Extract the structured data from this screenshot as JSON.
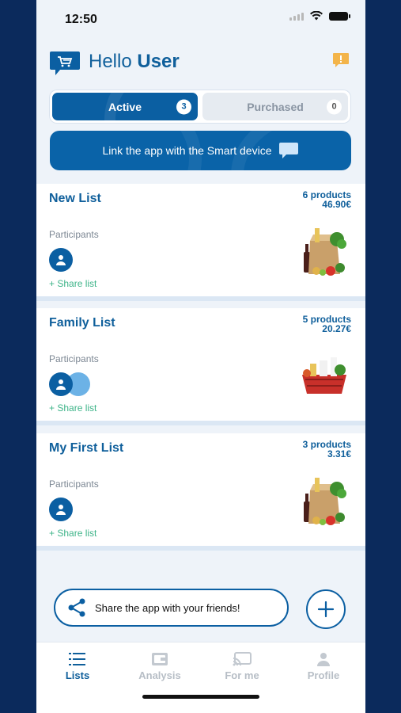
{
  "status": {
    "time": "12:50"
  },
  "header": {
    "greeting": "Hello",
    "user": "User"
  },
  "segments": [
    {
      "label": "Active",
      "count": "3"
    },
    {
      "label": "Purchased",
      "count": "0"
    }
  ],
  "link_banner": {
    "label": "Link the app with the Smart device"
  },
  "lists": [
    {
      "title": "New List",
      "products": "6 products",
      "total": "46.90€",
      "participants_label": "Participants",
      "share_label": "+ Share list"
    },
    {
      "title": "Family List",
      "products": "5 products",
      "total": "20.27€",
      "participants_label": "Participants",
      "share_label": "+ Share list"
    },
    {
      "title": "My First List",
      "products": "3 products",
      "total": "3.31€",
      "participants_label": "Participants",
      "share_label": "+ Share list"
    }
  ],
  "share_app": {
    "label": "Share the app with your friends!"
  },
  "tabs": [
    {
      "label": "Lists",
      "icon": "list-icon"
    },
    {
      "label": "Analysis",
      "icon": "wallet-icon"
    },
    {
      "label": "For me",
      "icon": "cast-icon"
    },
    {
      "label": "Profile",
      "icon": "person-icon"
    }
  ],
  "colors": {
    "primary": "#0b5fa2",
    "accent_green": "#3eb489",
    "background": "#0b2a5c"
  }
}
